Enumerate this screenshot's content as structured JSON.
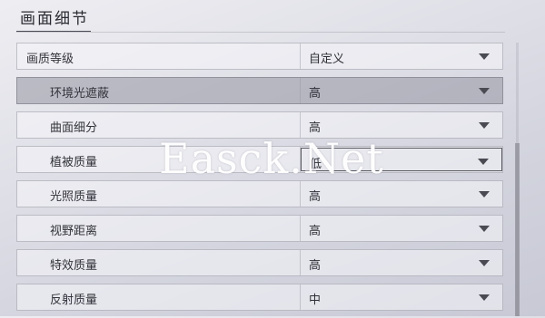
{
  "section": {
    "title": "画面细节"
  },
  "settings": [
    {
      "label": "画质等级",
      "value": "自定义"
    },
    {
      "label": "环境光遮蔽",
      "value": "高"
    },
    {
      "label": "曲面细分",
      "value": "高"
    },
    {
      "label": "植被质量",
      "value": "低"
    },
    {
      "label": "光照质量",
      "value": "高"
    },
    {
      "label": "视野距离",
      "value": "高"
    },
    {
      "label": "特效质量",
      "value": "高"
    },
    {
      "label": "反射质量",
      "value": "中"
    }
  ],
  "watermark": {
    "text": "Easck.Net"
  }
}
